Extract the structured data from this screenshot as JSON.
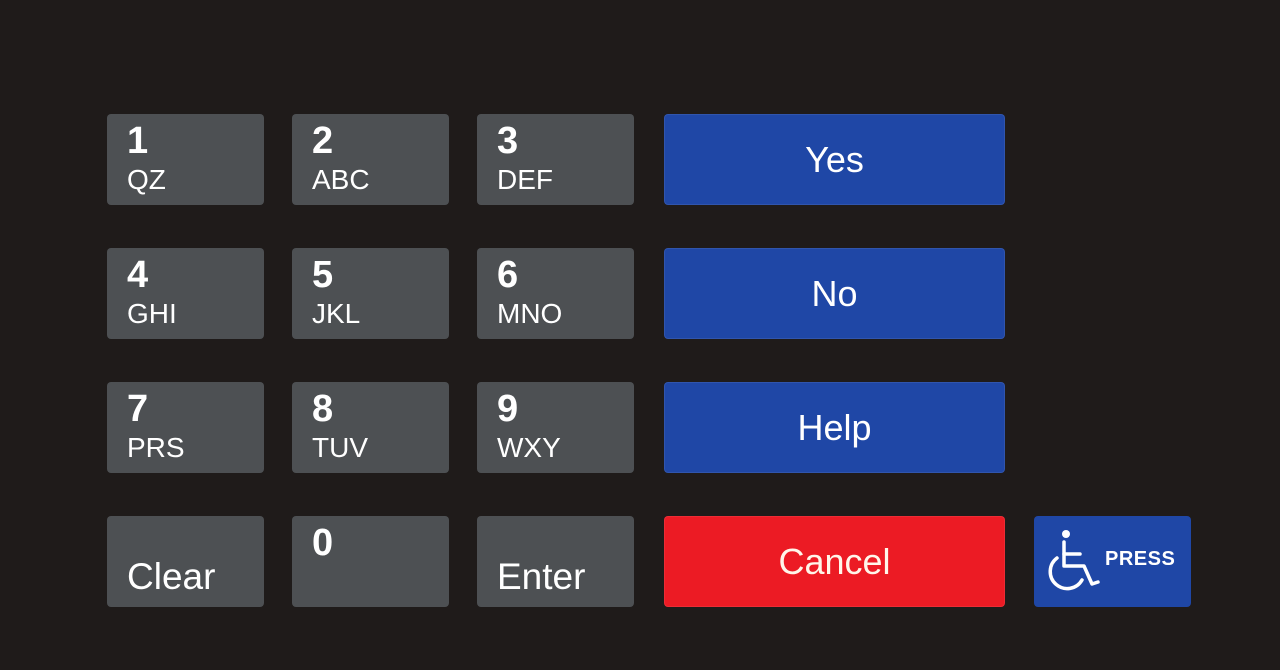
{
  "keypad": {
    "number_keys": [
      {
        "digit": "1",
        "letters": "QZ"
      },
      {
        "digit": "2",
        "letters": "ABC"
      },
      {
        "digit": "3",
        "letters": "DEF"
      },
      {
        "digit": "4",
        "letters": "GHI"
      },
      {
        "digit": "5",
        "letters": "JKL"
      },
      {
        "digit": "6",
        "letters": "MNO"
      },
      {
        "digit": "7",
        "letters": "PRS"
      },
      {
        "digit": "8",
        "letters": "TUV"
      },
      {
        "digit": "9",
        "letters": "WXY"
      },
      {
        "digit": "0",
        "letters": ""
      }
    ],
    "clear_label": "Clear",
    "enter_label": "Enter",
    "yes_label": "Yes",
    "no_label": "No",
    "help_label": "Help",
    "cancel_label": "Cancel",
    "accessibility": {
      "icon": "wheelchair-icon",
      "label": "PRESS"
    }
  },
  "colors": {
    "background": "#1f1b1a",
    "number_key": "#4d5053",
    "function_key_blue": "#1f47a6",
    "cancel_red": "#ec1b24",
    "text": "#ffffff"
  }
}
